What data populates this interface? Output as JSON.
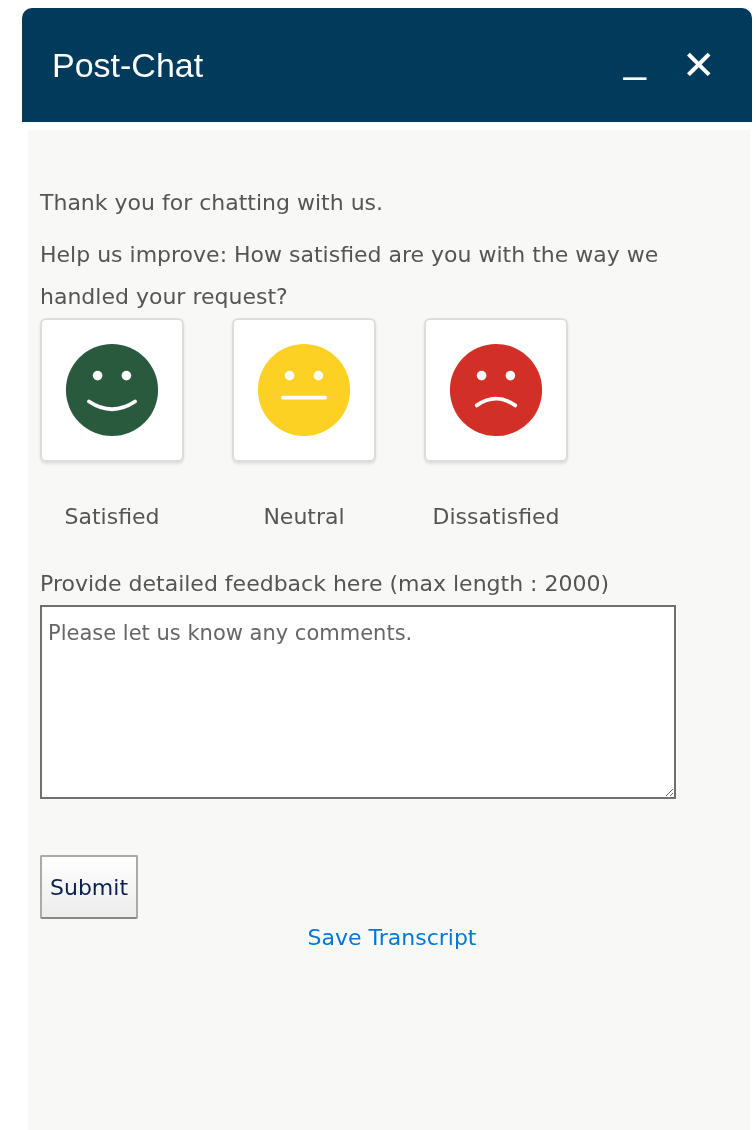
{
  "window": {
    "title": "Post-Chat",
    "minimize_label": "_",
    "close_label": "✕"
  },
  "intro": "Thank you for chatting with us.",
  "question": "Help us improve: How satisfied are you with the way we handled your request?",
  "ratings": [
    {
      "label": "Satisfied",
      "kind": "smile",
      "color": "#2a5a3e"
    },
    {
      "label": "Neutral",
      "kind": "neutral",
      "color": "#fcd124"
    },
    {
      "label": "Dissatisfied",
      "kind": "frown",
      "color": "#d23026"
    }
  ],
  "feedback": {
    "label": "Provide detailed feedback here (max length : 2000)",
    "placeholder": "Please let us know any comments."
  },
  "submit": "Submit",
  "link": "Save Transcript"
}
